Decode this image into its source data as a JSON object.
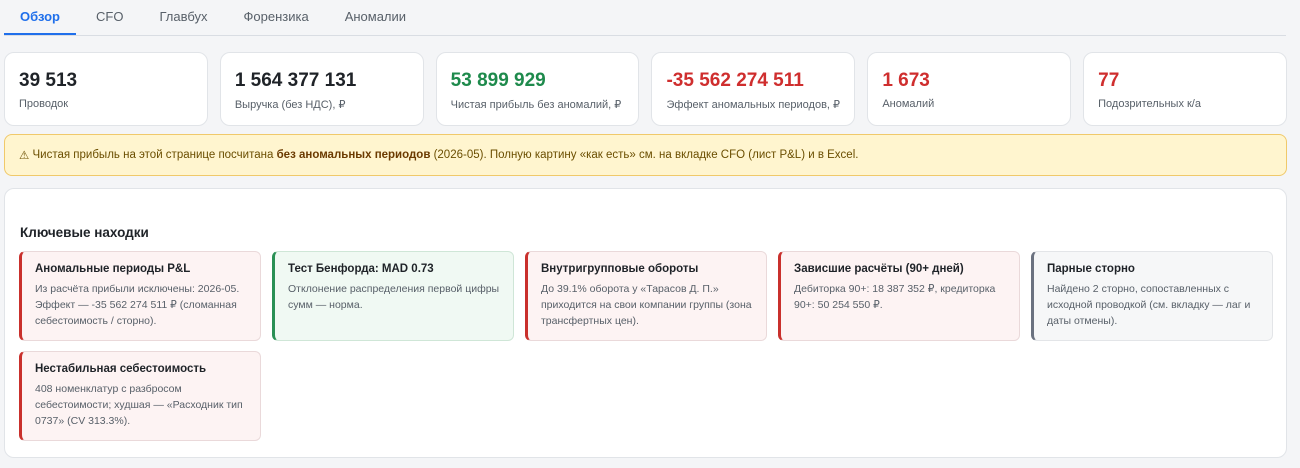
{
  "tabs": [
    {
      "label": "Обзор",
      "active": true
    },
    {
      "label": "CFO",
      "active": false
    },
    {
      "label": "Главбух",
      "active": false
    },
    {
      "label": "Форензика",
      "active": false
    },
    {
      "label": "Аномалии",
      "active": false
    }
  ],
  "kpis": [
    {
      "value": "39 513",
      "label": "Проводок",
      "color": "#1f2328"
    },
    {
      "value": "1 564 377 131",
      "label": "Выручка (без НДС), ₽",
      "color": "#1f2328"
    },
    {
      "value": "53 899 929",
      "label": "Чистая прибыль без аномалий, ₽",
      "color": "#1e8a4c"
    },
    {
      "value": "-35 562 274 511",
      "label": "Эффект аномальных периодов, ₽",
      "color": "#cf2e2e"
    },
    {
      "value": "1 673",
      "label": "Аномалий",
      "color": "#cf2e2e"
    },
    {
      "value": "77",
      "label": "Подозрительных к/а",
      "color": "#cf2e2e"
    }
  ],
  "alert": {
    "icon": "⚠",
    "text_before": " Чистая прибыль на этой странице посчитана ",
    "text_bold": "без аномальных периодов",
    "text_after": " (2026-05). Полную картину «как есть» см. на вкладке CFO (лист P&L) и в Excel."
  },
  "findings": {
    "title": "Ключевые находки",
    "items": [
      {
        "title": "Аномальные периоды P&L",
        "desc": "Из расчёта прибыли исключены: 2026-05. Эффект — -35 562 274 511 ₽ (сломанная себестоимость / сторно).",
        "tone": "red"
      },
      {
        "title": "Тест Бенфорда: MAD 0.73",
        "desc": "Отклонение распределения первой цифры сумм — норма.",
        "tone": "green"
      },
      {
        "title": "Внутригрупповые обороты",
        "desc": "До 39.1% оборота у «Тарасов Д. П.» приходится на свои компании группы (зона трансфертных цен).",
        "tone": "red"
      },
      {
        "title": "Зависшие расчёты (90+ дней)",
        "desc": "Дебиторка 90+: 18 387 352 ₽, кредиторка 90+: 50 254 550 ₽.",
        "tone": "red"
      },
      {
        "title": "Парные сторно",
        "desc": "Найдено 2 сторно, сопоставленных с исходной проводкой (см. вкладку — лаг и даты отмены).",
        "tone": "gray"
      },
      {
        "title": "Нестабильная себестоимость",
        "desc": "408 номенклатур с разбросом себестоимости; худшая — «Расходник тип 0737» (CV 313.3%).",
        "tone": "red"
      }
    ]
  }
}
